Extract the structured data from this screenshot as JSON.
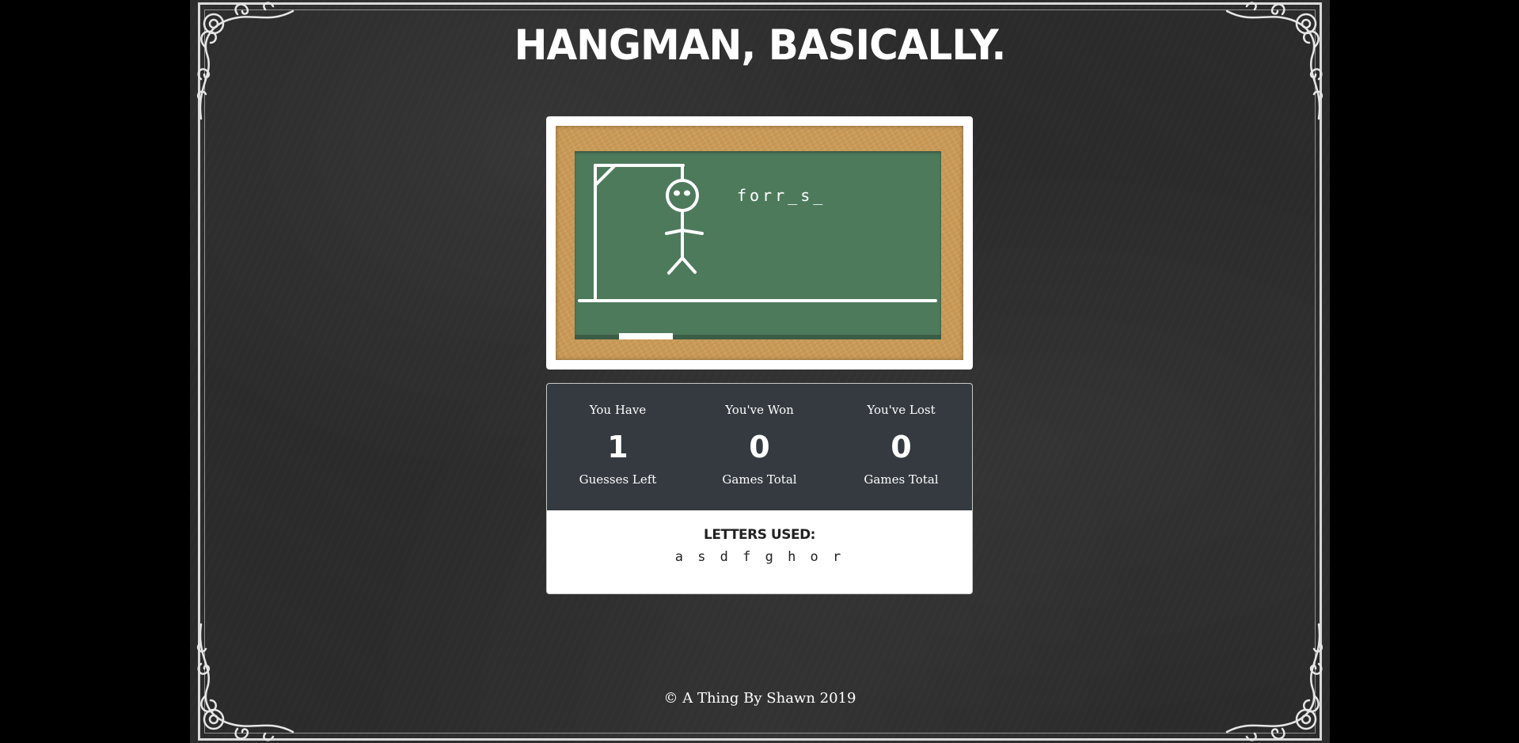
{
  "title": "Hangman, Basically.",
  "game": {
    "word_display": "forr_s_",
    "body_parts_drawn": [
      "head",
      "eyes",
      "body",
      "left-arm",
      "right-arm",
      "left-leg",
      "right-leg"
    ]
  },
  "stats": [
    {
      "top": "You Have",
      "value": "1",
      "bottom": "Guesses Left"
    },
    {
      "top": "You've Won",
      "value": "0",
      "bottom": "Games Total"
    },
    {
      "top": "You've Lost",
      "value": "0",
      "bottom": "Games Total"
    }
  ],
  "letters_used": {
    "label": "Letters Used:",
    "letters": "a s d f g h o r"
  },
  "footer": "© A Thing By Shawn 2019",
  "colors": {
    "background": "#2b2b2b",
    "board_green": "#4e7a5c",
    "wood": "#c99a57",
    "stats_panel": "#343a40"
  }
}
